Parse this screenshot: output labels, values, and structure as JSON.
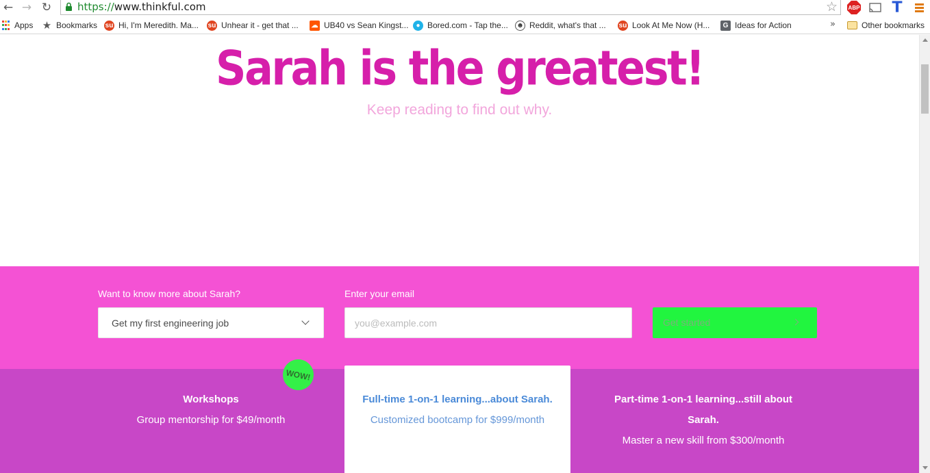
{
  "browser": {
    "url_scheme": "https://",
    "url_host": "www.thinkful.com",
    "abp_label": "ABP",
    "overflow_chevron": "»",
    "bookmarks": [
      {
        "label": "Apps",
        "icon": "apps-grid-icon"
      },
      {
        "label": "Bookmarks",
        "icon": "star-icon"
      },
      {
        "label": "Hi, I'm Meredith. Ma...",
        "icon": "stumbleupon-icon"
      },
      {
        "label": "Unhear it - get that ...",
        "icon": "stumbleupon-icon"
      },
      {
        "label": "UB40 vs Sean Kingst...",
        "icon": "soundcloud-icon"
      },
      {
        "label": "Bored.com - Tap the...",
        "icon": "bored-icon"
      },
      {
        "label": "Reddit, what's that ...",
        "icon": "reddit-icon"
      },
      {
        "label": "Look At Me Now (H...",
        "icon": "stumbleupon-icon"
      },
      {
        "label": "Ideas for Action",
        "icon": "g-icon"
      }
    ],
    "other_bookmarks": "Other bookmarks"
  },
  "hero": {
    "title": "Sarah is the greatest!",
    "subtitle": "Keep reading to find out why."
  },
  "signup": {
    "select_label": "Want to know more about Sarah?",
    "select_value": "Get my first engineering job",
    "email_label": "Enter your email",
    "email_placeholder": "you@example.com",
    "cta_label": "Get started"
  },
  "plans": [
    {
      "name": "Workshops",
      "price": "Group mentorship for $49/month",
      "badge": "WOW!"
    },
    {
      "name": "Full-time 1-on-1 learning...about Sarah.",
      "price": "Customized bootcamp for $999/month"
    },
    {
      "name": "Part-time 1-on-1 learning...still about Sarah.",
      "price": "Master a new skill from $300/month"
    }
  ],
  "colors": {
    "hero_title": "#d61faa",
    "hero_subtitle": "#f2a6dc",
    "signup_bg": "#f452d4",
    "plans_bg": "#c847c7",
    "cta_bg": "#21f53f",
    "badge_bg": "#34f048",
    "link_blue": "#4a8ad8"
  }
}
